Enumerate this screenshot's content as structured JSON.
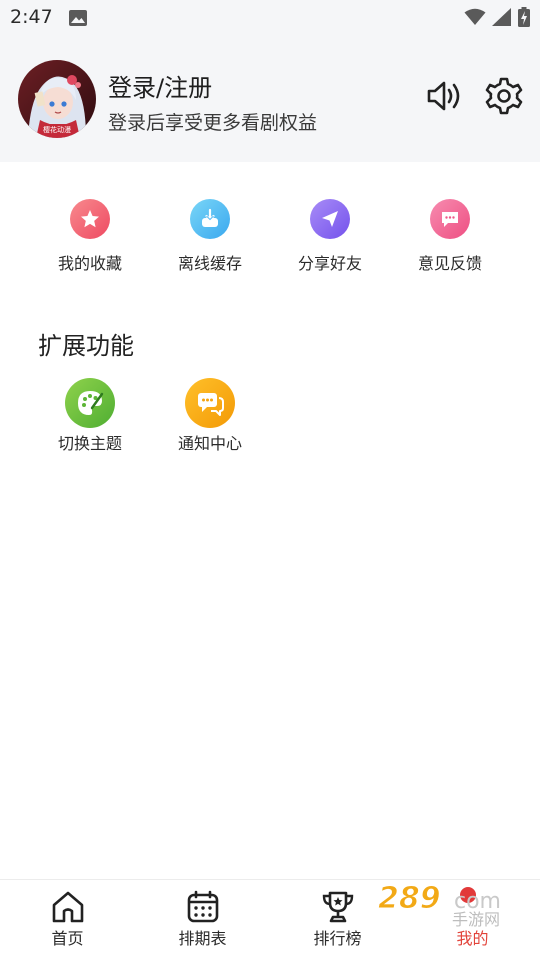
{
  "status_bar": {
    "time": "2:47",
    "icons": [
      "image-icon",
      "wifi-icon",
      "signal-icon",
      "battery-charging-icon"
    ]
  },
  "header": {
    "title": "登录/注册",
    "subtitle": "登录后享受更多看剧权益",
    "avatar_caption": "樱花动漫",
    "icons": [
      "speaker-icon",
      "gear-icon"
    ]
  },
  "quick_actions": [
    {
      "label": "我的收藏",
      "icon": "star-icon",
      "color": "#f0566a"
    },
    {
      "label": "离线缓存",
      "icon": "download-icon",
      "color": "#4ab6f0"
    },
    {
      "label": "分享好友",
      "icon": "paper-plane-icon",
      "color": "#8b6af0"
    },
    {
      "label": "意见反馈",
      "icon": "chat-bubble-icon",
      "color": "#f0608c"
    }
  ],
  "extensions": {
    "title": "扩展功能",
    "items": [
      {
        "label": "切换主题",
        "icon": "palette-icon",
        "color": "#6cbf3e"
      },
      {
        "label": "通知中心",
        "icon": "message-icon",
        "color": "#f7a410"
      }
    ]
  },
  "bottom_nav": {
    "items": [
      {
        "label": "首页",
        "icon": "home-icon"
      },
      {
        "label": "排期表",
        "icon": "calendar-icon"
      },
      {
        "label": "排行榜",
        "icon": "trophy-icon"
      },
      {
        "label": "我的",
        "icon": "profile-icon"
      }
    ],
    "active_index": 3,
    "active_color": "#e2433a"
  },
  "watermark": {
    "text": "289",
    "suffix": "com",
    "cn": "手游网"
  }
}
